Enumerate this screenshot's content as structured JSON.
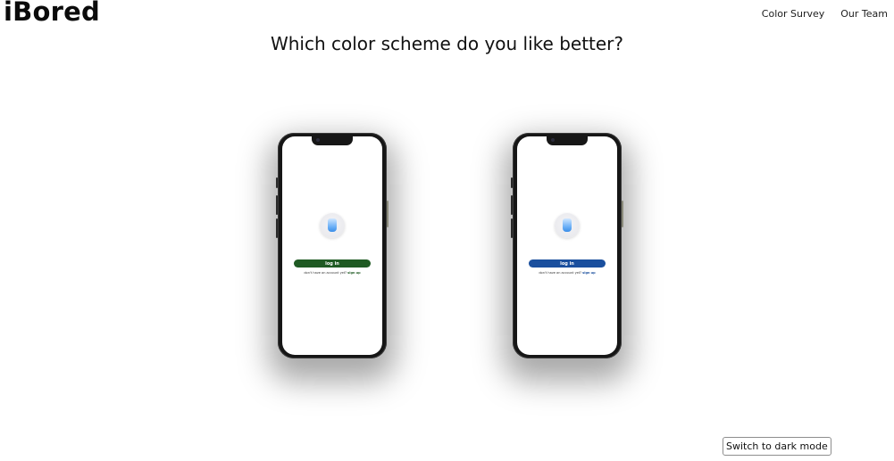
{
  "header": {
    "logo": "iBored",
    "nav": [
      "Color Survey",
      "Our Team"
    ]
  },
  "main": {
    "question": "Which color scheme do you like better?",
    "options": [
      {
        "login_label": "log in",
        "signup_prompt": "don't have an account yet?",
        "signup_link": "sign up",
        "button_color": "#1f5a23"
      },
      {
        "login_label": "log in",
        "signup_prompt": "don't have an account yet?",
        "signup_link": "sign up",
        "button_color": "#1a4f9e"
      }
    ]
  },
  "footer": {
    "dark_mode_label": "Switch to dark mode"
  }
}
